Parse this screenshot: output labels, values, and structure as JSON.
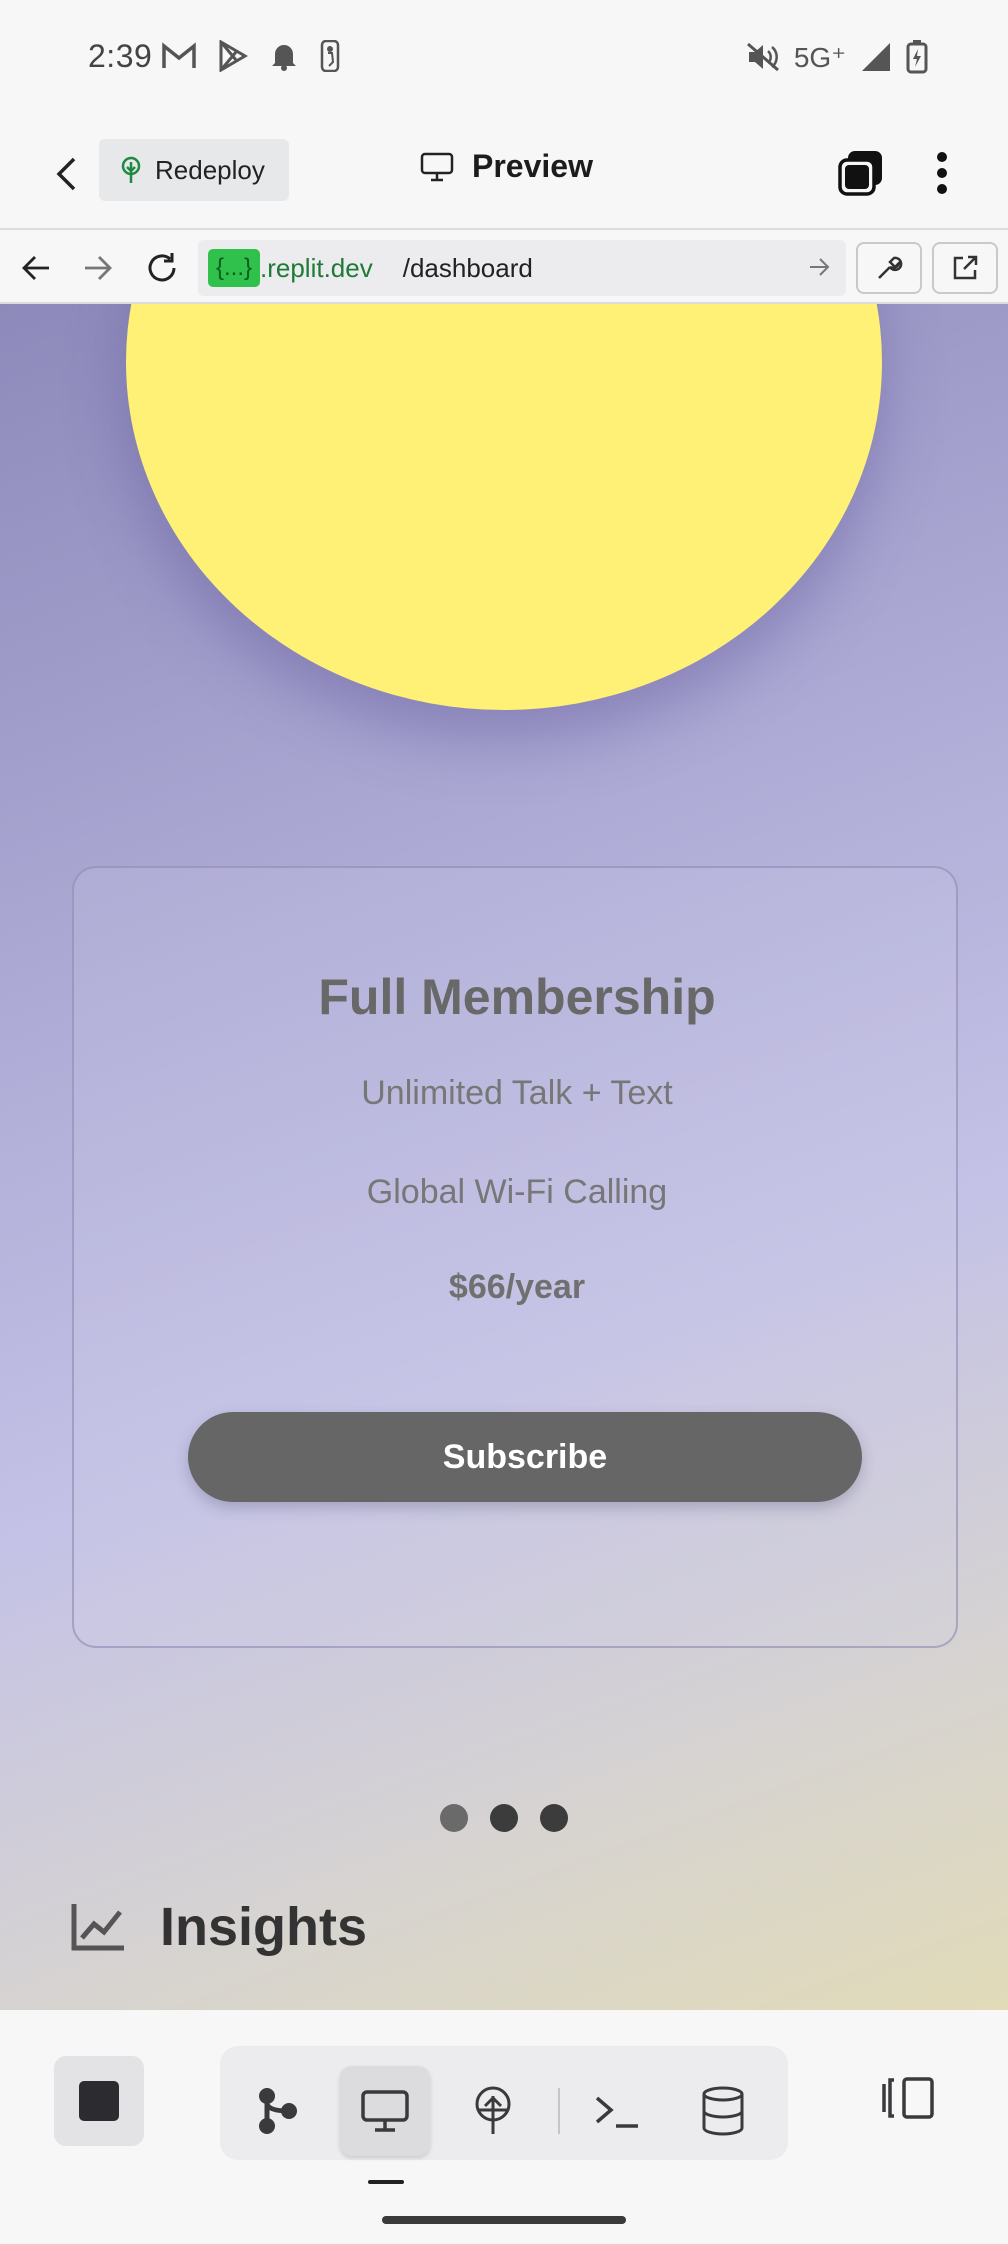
{
  "status_bar": {
    "time": "2:39",
    "network": "5G⁺",
    "left_icons": [
      "gmail-icon",
      "play-store-icon",
      "notification-bell-icon",
      "nba-icon"
    ],
    "right_icons": [
      "mute-icon",
      "signal-icon",
      "battery-charging-icon"
    ]
  },
  "header": {
    "redeploy_label": "Redeploy",
    "title": "Preview"
  },
  "url_bar": {
    "badge": "{...}",
    "domain": ".replit.dev",
    "path": "/dashboard"
  },
  "page": {
    "plan": {
      "title": "Full Membership",
      "features": [
        "Unlimited Talk + Text",
        "Global Wi-Fi Calling"
      ],
      "price": "$66/year",
      "cta": "Subscribe"
    },
    "carousel": {
      "count": 3,
      "active_index": 0
    },
    "insights": {
      "label": "Insights",
      "icon": "line-chart-icon"
    }
  },
  "colors": {
    "sun": "#fef176",
    "button": "#666666",
    "badge": "#2fc14b"
  },
  "bottom_toolbar": {
    "items": [
      "stop-icon",
      "git-icon",
      "preview-icon",
      "deploy-icon",
      "shell-icon",
      "database-icon",
      "split-view-icon"
    ],
    "active": "preview-icon"
  }
}
